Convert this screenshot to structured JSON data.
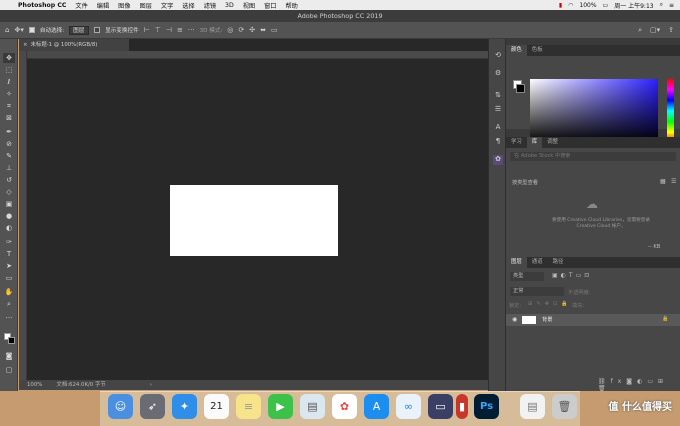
{
  "menubar": {
    "apple": "",
    "app": "Photoshop CC",
    "items": [
      "文件",
      "编辑",
      "图像",
      "图层",
      "文字",
      "选择",
      "滤镜",
      "3D",
      "视图",
      "窗口",
      "帮助"
    ],
    "battery": "100%",
    "clock": "周一 上午9:13"
  },
  "window": {
    "title": "Adobe Photoshop CC 2019"
  },
  "options": {
    "auto_select_label": "自动选择:",
    "auto_select_value": "图层",
    "transform_label": "显示变换控件",
    "mode3d": "3D 模式:"
  },
  "document": {
    "tab": "未标题-1 @ 100%(RGB/8)",
    "zoom": "100%",
    "info": "文档:624.0K/0 字节"
  },
  "panels": {
    "color_tabs": [
      "颜色",
      "色板"
    ],
    "mid_tabs": [
      "学习",
      "库",
      "调整"
    ],
    "lib_search_placeholder": "在 Adobe Stock 中搜索",
    "lib_view_label": "按类型查看",
    "lib_message": "要使用 Creative Cloud Libraries，您需要登录 Creative Cloud 帐户。",
    "lib_size": "-- KB",
    "layer_tabs": [
      "图层",
      "通道",
      "路径"
    ],
    "layer_kind": "类型",
    "blend_mode": "正常",
    "opacity_label": "不透明度:",
    "lock_label": "锁定:",
    "fill_label": "填充:",
    "layer_name": "背景"
  },
  "watermark": "值 什么值得买"
}
